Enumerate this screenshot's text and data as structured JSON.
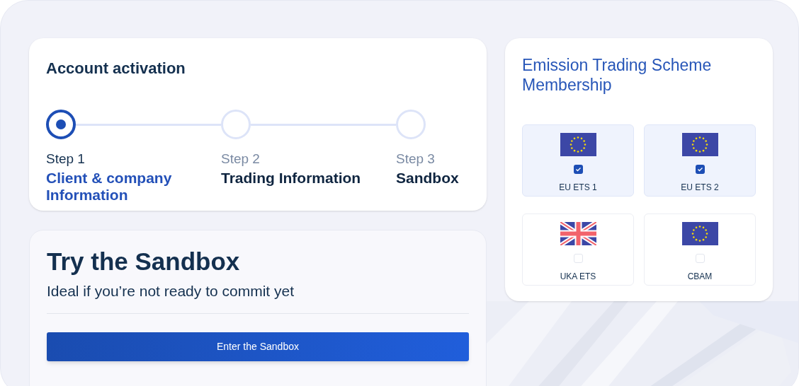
{
  "activation": {
    "title": "Account activation",
    "steps": [
      {
        "label": "Step 1",
        "title": "Client & company Information",
        "current": true
      },
      {
        "label": "Step 2",
        "title": "Trading Information",
        "current": false
      },
      {
        "label": "Step 3",
        "title": "Sandbox",
        "current": false
      }
    ]
  },
  "sandbox": {
    "title": "Try the Sandbox",
    "subtitle": "Ideal if you’re not ready to commit yet",
    "button": "Enter the Sandbox"
  },
  "membership": {
    "title": "Emission Trading Scheme Membership",
    "schemes": [
      {
        "label": "EU ETS 1",
        "kind": "eu",
        "checked": true
      },
      {
        "label": "EU ETS 2",
        "kind": "eu",
        "checked": true
      },
      {
        "label": "UKA ETS",
        "kind": "uk",
        "checked": false
      },
      {
        "label": "CBAM",
        "kind": "eu",
        "checked": false
      }
    ]
  }
}
